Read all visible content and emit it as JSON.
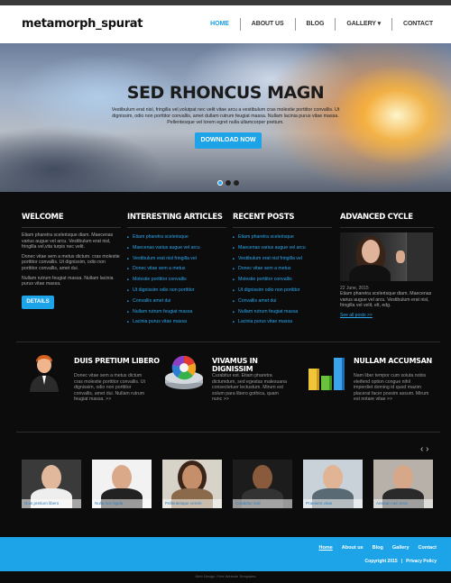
{
  "header": {
    "logo": "metamorph_spurat",
    "nav": [
      "HOME",
      "ABOUT US",
      "BLOG",
      "GALLERY ▾",
      "CONTACT"
    ]
  },
  "hero": {
    "title": "SED RHONCUS MAGN",
    "text": "Vestibulum erat nisl, fringilla vel,volutpat nec velit vitae arcu a vestibulum cras molestie porttitor convallis. Ut dignissim, odio non porttitor convallis, amet dullam rutrum feugiat massa. Nullam lacinia purus vitae massa. Pellentesque vel lorem egret nulla ullamcorper pretium.",
    "button": "DOWNLOAD NOW",
    "slide_count": 3,
    "active_slide": 1
  },
  "welcome": {
    "title": "WELCOME",
    "paragraphs": [
      "Etiam pharetra scelerisque diam. Maecenas varius augue vel arcu. Vestibulum erat nisl, fringilla vel,vita turpis nec velit.",
      "Donec vitae sem a metus dictum. cras molestie porttitor convallis. Ut dignissim, odio non porttitor convallis, amet dui.",
      "Nullam rutrum feugiat massa. Nullam lacinia purus vitae massa."
    ],
    "button": "DETAILS"
  },
  "articles": {
    "title": "INTERESTING ARTICLES",
    "items": [
      "Etiam pharetra scelerisque",
      "Maecenas varius augue vel arcu",
      "Vestibulum erat nisl fringilla vel",
      "Donec vitae sem a metus",
      "Molestie porttitor convallis",
      "Ut dignissim odio non porttitor",
      "Convallis amet dui",
      "Nullam rutrum feugiat massa",
      "Lacinia purus vitae massa"
    ]
  },
  "recent": {
    "title": "RECENT POSTS",
    "items": [
      "Etiam pharetra scelerisque",
      "Maecenas varius augue vel arcu",
      "Vestibulum erat nisl fringilla vel",
      "Donec vitae sem a metus",
      "Molestie porttitor convallis",
      "Ut dignissim odio non porttitor",
      "Convallis amet dui",
      "Nullam rutrum feugiat massa",
      "Lacinia purus vitae massa"
    ]
  },
  "advanced": {
    "title": "ADVANCED CYCLE",
    "date": "22 June, 2015",
    "text": "Etiam pharetra scelerisque diam. Maecenas varius augue vel arcu. Vestibulum erat nisl, fringilla vel velit, elt, edg.",
    "see_all": "See all posts >>"
  },
  "features": [
    {
      "title": "DUIS PRETIUM LIBERO",
      "text": "Donec vitae sem a metus dictum cras molestie porttitor convallis. Ut dignissim, odio non porttitor convallis, amet dui. Nullam rutrum feugiat massa. >>",
      "icon": "person-icon"
    },
    {
      "title": "VIVAMUS IN DIGNISSIM",
      "text": "Curabitur est. Etiam pharetra dictumdum, sed egestas malesuana consectetuer lectustum. Mirum est solum para libero gothica, quam nunc >>",
      "icon": "color-wheel-icon"
    },
    {
      "title": "NULLAM ACCUMSAN",
      "text": "Nam liber tempor cum soluta nobis eleifend option congue nihil imperdiet doming id quod mazim placerat facer possim assum. Mirum est notare vitae >>",
      "icon": "bar-chart-icon"
    }
  ],
  "thumbnails": [
    "Duis pretium libero",
    "Nulla nec ligula",
    "Pellentesque cerem",
    "Curabitur sed",
    "Praesent vitae",
    "Aenean nec eros"
  ],
  "footer": {
    "nav": [
      "Home",
      "About us",
      "Blog",
      "Gallery",
      "Contact"
    ],
    "copyright": "Copyright 2015",
    "privacy": "Privacy Policy",
    "credit": "Web Design: Free Website Templates"
  },
  "colors": {
    "accent": "#1ca3e8",
    "background": "#0c0c0c"
  }
}
